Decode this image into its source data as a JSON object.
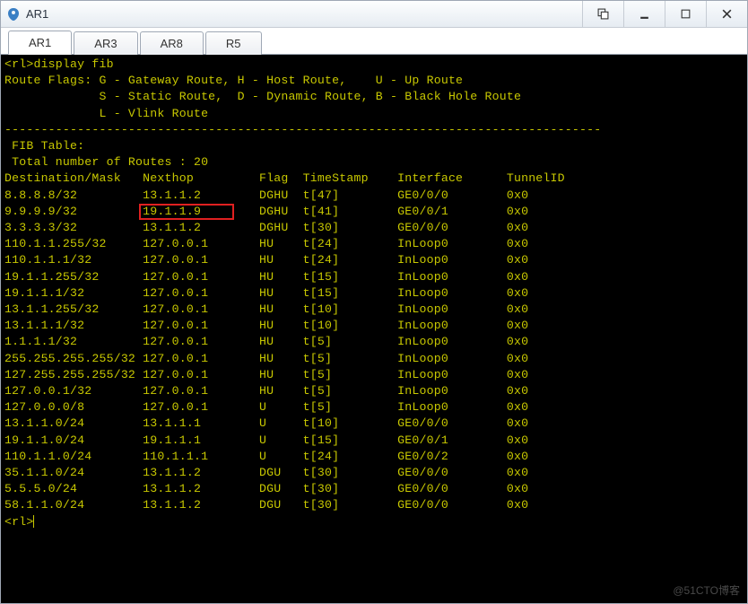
{
  "window": {
    "title": "AR1"
  },
  "tabs": [
    {
      "label": "AR1",
      "active": true
    },
    {
      "label": "AR3",
      "active": false
    },
    {
      "label": "AR8",
      "active": false
    },
    {
      "label": "R5",
      "active": false
    }
  ],
  "terminal": {
    "prompt": "<rl>",
    "command": "display fib",
    "flags_header": "Route Flags:",
    "flags_line1": " G - Gateway Route, H - Host Route,    U - Up Route",
    "flags_line2": "             S - Static Route,  D - Dynamic Route, B - Black Hole Route",
    "flags_line3": "             L - Vlink Route",
    "dash": "----------------------------------------------------------------------------------",
    "fib_label": " FIB Table:",
    "total_label": " Total number of Routes : ",
    "total_value": "20",
    "headers": {
      "dest": "Destination/Mask",
      "nexthop": "Nexthop",
      "flag": "Flag",
      "ts": "TimeStamp",
      "iface": "Interface",
      "tid": "TunnelID"
    },
    "rows": [
      {
        "dest": "8.8.8.8/32",
        "nexthop": "13.1.1.2",
        "flag": "DGHU",
        "ts": "t[47]",
        "iface": "GE0/0/0",
        "tid": "0x0",
        "hl": true
      },
      {
        "dest": "9.9.9.9/32",
        "nexthop": "19.1.1.9",
        "flag": "DGHU",
        "ts": "t[41]",
        "iface": "GE0/0/1",
        "tid": "0x0"
      },
      {
        "dest": "3.3.3.3/32",
        "nexthop": "13.1.1.2",
        "flag": "DGHU",
        "ts": "t[30]",
        "iface": "GE0/0/0",
        "tid": "0x0"
      },
      {
        "dest": "110.1.1.255/32",
        "nexthop": "127.0.0.1",
        "flag": "HU",
        "ts": "t[24]",
        "iface": "InLoop0",
        "tid": "0x0"
      },
      {
        "dest": "110.1.1.1/32",
        "nexthop": "127.0.0.1",
        "flag": "HU",
        "ts": "t[24]",
        "iface": "InLoop0",
        "tid": "0x0"
      },
      {
        "dest": "19.1.1.255/32",
        "nexthop": "127.0.0.1",
        "flag": "HU",
        "ts": "t[15]",
        "iface": "InLoop0",
        "tid": "0x0"
      },
      {
        "dest": "19.1.1.1/32",
        "nexthop": "127.0.0.1",
        "flag": "HU",
        "ts": "t[15]",
        "iface": "InLoop0",
        "tid": "0x0"
      },
      {
        "dest": "13.1.1.255/32",
        "nexthop": "127.0.0.1",
        "flag": "HU",
        "ts": "t[10]",
        "iface": "InLoop0",
        "tid": "0x0"
      },
      {
        "dest": "13.1.1.1/32",
        "nexthop": "127.0.0.1",
        "flag": "HU",
        "ts": "t[10]",
        "iface": "InLoop0",
        "tid": "0x0"
      },
      {
        "dest": "1.1.1.1/32",
        "nexthop": "127.0.0.1",
        "flag": "HU",
        "ts": "t[5]",
        "iface": "InLoop0",
        "tid": "0x0"
      },
      {
        "dest": "255.255.255.255/32",
        "nexthop": "127.0.0.1",
        "flag": "HU",
        "ts": "t[5]",
        "iface": "InLoop0",
        "tid": "0x0"
      },
      {
        "dest": "127.255.255.255/32",
        "nexthop": "127.0.0.1",
        "flag": "HU",
        "ts": "t[5]",
        "iface": "InLoop0",
        "tid": "0x0"
      },
      {
        "dest": "127.0.0.1/32",
        "nexthop": "127.0.0.1",
        "flag": "HU",
        "ts": "t[5]",
        "iface": "InLoop0",
        "tid": "0x0"
      },
      {
        "dest": "127.0.0.0/8",
        "nexthop": "127.0.0.1",
        "flag": "U",
        "ts": "t[5]",
        "iface": "InLoop0",
        "tid": "0x0"
      },
      {
        "dest": "13.1.1.0/24",
        "nexthop": "13.1.1.1",
        "flag": "U",
        "ts": "t[10]",
        "iface": "GE0/0/0",
        "tid": "0x0"
      },
      {
        "dest": "19.1.1.0/24",
        "nexthop": "19.1.1.1",
        "flag": "U",
        "ts": "t[15]",
        "iface": "GE0/0/1",
        "tid": "0x0"
      },
      {
        "dest": "110.1.1.0/24",
        "nexthop": "110.1.1.1",
        "flag": "U",
        "ts": "t[24]",
        "iface": "GE0/0/2",
        "tid": "0x0"
      },
      {
        "dest": "35.1.1.0/24",
        "nexthop": "13.1.1.2",
        "flag": "DGU",
        "ts": "t[30]",
        "iface": "GE0/0/0",
        "tid": "0x0"
      },
      {
        "dest": "5.5.5.0/24",
        "nexthop": "13.1.1.2",
        "flag": "DGU",
        "ts": "t[30]",
        "iface": "GE0/0/0",
        "tid": "0x0"
      },
      {
        "dest": "58.1.1.0/24",
        "nexthop": "13.1.1.2",
        "flag": "DGU",
        "ts": "t[30]",
        "iface": "GE0/0/0",
        "tid": "0x0"
      }
    ],
    "prompt_end": "<rl>"
  },
  "watermark": "@51CTO博客"
}
